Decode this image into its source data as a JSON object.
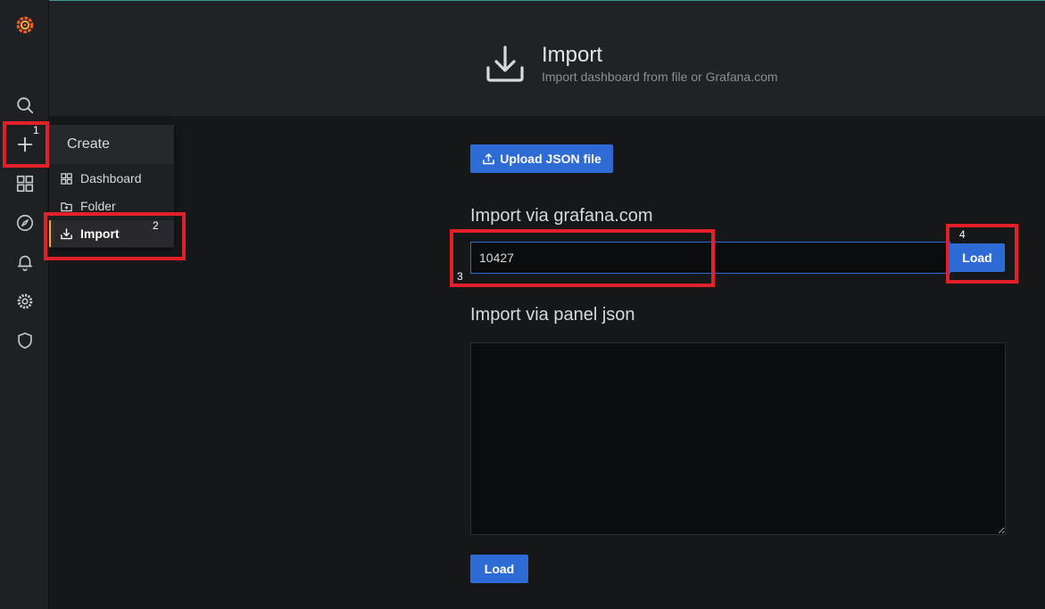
{
  "sidebar": {
    "items": [
      {
        "icon": "grafana-logo"
      },
      {
        "icon": "search-icon"
      },
      {
        "icon": "plus-icon"
      },
      {
        "icon": "dashboards-icon"
      },
      {
        "icon": "explore-icon"
      },
      {
        "icon": "bell-icon"
      },
      {
        "icon": "gear-icon"
      },
      {
        "icon": "shield-icon"
      }
    ]
  },
  "header": {
    "title": "Import",
    "subtitle": "Import dashboard from file or Grafana.com"
  },
  "create_menu": {
    "title": "Create",
    "items": [
      {
        "label": "Dashboard",
        "icon": "dashboards-icon"
      },
      {
        "label": "Folder",
        "icon": "folder-plus-icon"
      },
      {
        "label": "Import",
        "icon": "import-icon",
        "active": true
      }
    ]
  },
  "main": {
    "upload_label": "Upload JSON file",
    "gcom_title": "Import via grafana.com",
    "gcom_value": "10427",
    "gcom_load_label": "Load",
    "panel_json_title": "Import via panel json",
    "panel_json_value": "",
    "panel_load_label": "Load"
  },
  "annotations": {
    "labels": [
      "1",
      "2",
      "3",
      "4"
    ],
    "color": "#e3202a"
  },
  "colors": {
    "accent": "#2f6bd5",
    "active_marker": "#f5a623",
    "brand": "#f05a28"
  }
}
